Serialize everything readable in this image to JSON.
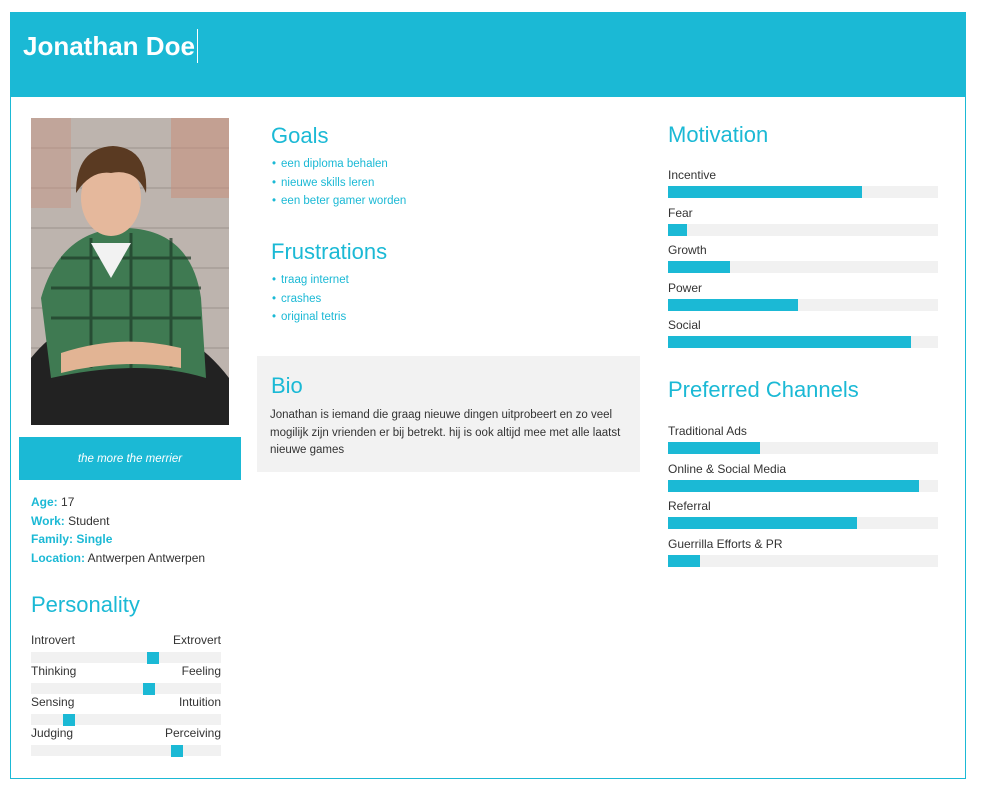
{
  "persona": {
    "name": "Jonathan Doe",
    "quote": "the more the merrier"
  },
  "facts": {
    "age_label": "Age:",
    "age": "17",
    "work_label": "Work:",
    "work": "Student",
    "family_label": "Family:",
    "family": "Single",
    "location_label": "Location:",
    "location": "Antwerpen Antwerpen"
  },
  "personality": {
    "title": "Personality",
    "traits": [
      {
        "left": "Introvert",
        "right": "Extrovert",
        "value": 0.64
      },
      {
        "left": "Thinking",
        "right": "Feeling",
        "value": 0.62
      },
      {
        "left": "Sensing",
        "right": "Intuition",
        "value": 0.2
      },
      {
        "left": "Judging",
        "right": "Perceiving",
        "value": 0.77
      }
    ]
  },
  "goals": {
    "title": "Goals",
    "items": [
      "een diploma behalen",
      "nieuwe skills leren",
      "een beter gamer worden"
    ]
  },
  "frustrations": {
    "title": "Frustrations",
    "items": [
      "traag internet",
      "crashes",
      "original tetris"
    ]
  },
  "bio": {
    "title": "Bio",
    "text": "Jonathan is iemand die graag nieuwe dingen uitprobeert en zo veel mogilijk zijn vrienden er bij betrekt. hij is ook altijd mee met alle laatst nieuwe games"
  },
  "motivation": {
    "title": "Motivation",
    "items": [
      {
        "label": "Incentive",
        "value": 0.72
      },
      {
        "label": "Fear",
        "value": 0.07
      },
      {
        "label": "Growth",
        "value": 0.23
      },
      {
        "label": "Power",
        "value": 0.48
      },
      {
        "label": "Social",
        "value": 0.9
      }
    ]
  },
  "channels": {
    "title": "Preferred Channels",
    "items": [
      {
        "label": "Traditional Ads",
        "value": 0.34
      },
      {
        "label": "Online & Social Media",
        "value": 0.93
      },
      {
        "label": "Referral",
        "value": 0.7
      },
      {
        "label": "Guerrilla Efforts & PR",
        "value": 0.12
      }
    ]
  },
  "colors": {
    "accent": "#1bb9d5",
    "panel": "#f2f2f2",
    "track": "#f1f1f1"
  }
}
